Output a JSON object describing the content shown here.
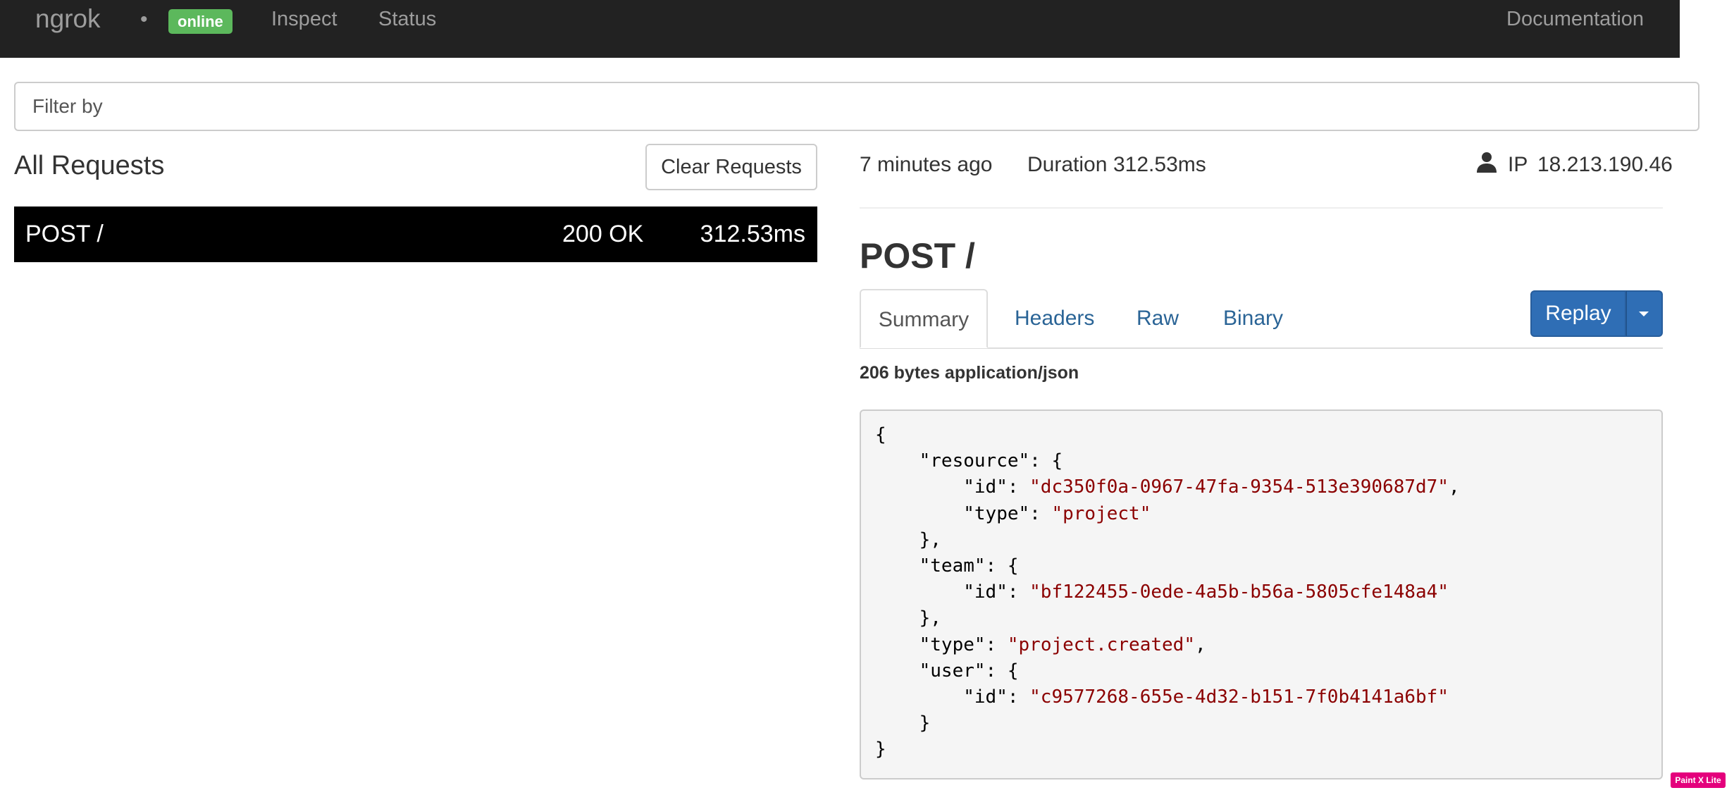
{
  "navbar": {
    "brand": "ngrok",
    "separator": "•",
    "status_badge": "online",
    "links": {
      "inspect": "Inspect",
      "status": "Status",
      "documentation": "Documentation"
    }
  },
  "filter": {
    "placeholder": "Filter by",
    "value": ""
  },
  "requests": {
    "title": "All Requests",
    "clear_label": "Clear Requests",
    "items": [
      {
        "method_path": "POST /",
        "status": "200 OK",
        "duration": "312.53ms"
      }
    ]
  },
  "detail": {
    "time_ago": "7 minutes ago",
    "duration_label": "Duration",
    "duration_value": "312.53ms",
    "ip_label": "IP",
    "ip_value": "18.213.190.46",
    "title": "POST /",
    "tabs": {
      "summary": "Summary",
      "headers": "Headers",
      "raw": "Raw",
      "binary": "Binary"
    },
    "replay_label": "Replay",
    "body_meta": "206 bytes application/json",
    "json_lines": [
      {
        "indent": 0,
        "parts": [
          {
            "t": "p",
            "v": "{"
          }
        ]
      },
      {
        "indent": 1,
        "parts": [
          {
            "t": "p",
            "v": "\"resource\": {"
          }
        ]
      },
      {
        "indent": 2,
        "parts": [
          {
            "t": "p",
            "v": "\"id\": "
          },
          {
            "t": "s",
            "v": "\"dc350f0a-0967-47fa-9354-513e390687d7\""
          },
          {
            "t": "p",
            "v": ","
          }
        ]
      },
      {
        "indent": 2,
        "parts": [
          {
            "t": "p",
            "v": "\"type\": "
          },
          {
            "t": "s",
            "v": "\"project\""
          }
        ]
      },
      {
        "indent": 1,
        "parts": [
          {
            "t": "p",
            "v": "},"
          }
        ]
      },
      {
        "indent": 1,
        "parts": [
          {
            "t": "p",
            "v": "\"team\": {"
          }
        ]
      },
      {
        "indent": 2,
        "parts": [
          {
            "t": "p",
            "v": "\"id\": "
          },
          {
            "t": "s",
            "v": "\"bf122455-0ede-4a5b-b56a-5805cfe148a4\""
          }
        ]
      },
      {
        "indent": 1,
        "parts": [
          {
            "t": "p",
            "v": "},"
          }
        ]
      },
      {
        "indent": 1,
        "parts": [
          {
            "t": "p",
            "v": "\"type\": "
          },
          {
            "t": "s",
            "v": "\"project.created\""
          },
          {
            "t": "p",
            "v": ","
          }
        ]
      },
      {
        "indent": 1,
        "parts": [
          {
            "t": "p",
            "v": "\"user\": {"
          }
        ]
      },
      {
        "indent": 2,
        "parts": [
          {
            "t": "p",
            "v": "\"id\": "
          },
          {
            "t": "s",
            "v": "\"c9577268-655e-4d32-b151-7f0b4141a6bf\""
          }
        ]
      },
      {
        "indent": 1,
        "parts": [
          {
            "t": "p",
            "v": "}"
          }
        ]
      },
      {
        "indent": 0,
        "parts": [
          {
            "t": "p",
            "v": "}"
          }
        ]
      }
    ]
  },
  "icons": {
    "ip": "user-icon",
    "replay_caret": "caret-down-icon"
  },
  "colors": {
    "navbar_bg": "#222222",
    "badge_online": "#5cb85c",
    "primary": "#2f6eb5",
    "link": "#2a6496",
    "json_string": "#8b0000"
  },
  "watermark": "Paint X Lite"
}
